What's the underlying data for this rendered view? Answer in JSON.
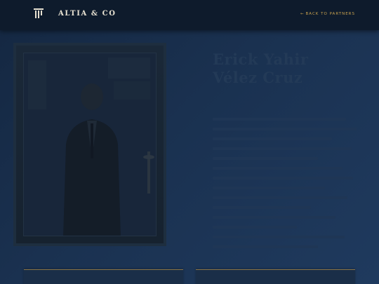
{
  "header": {
    "brand_name": "ALTIA & CO",
    "back_link_arrow": "←",
    "back_link_label": "BACK TO PARTNERS",
    "logo_icon": "column-pillar-icon"
  },
  "profile": {
    "name_line_1": "Erick Yahir",
    "name_line_2": "Vélez Cruz"
  },
  "colors": {
    "accent_gold": "#c9a24e",
    "header_bg": "#0e1b2c",
    "page_bg": "#1a3150"
  }
}
